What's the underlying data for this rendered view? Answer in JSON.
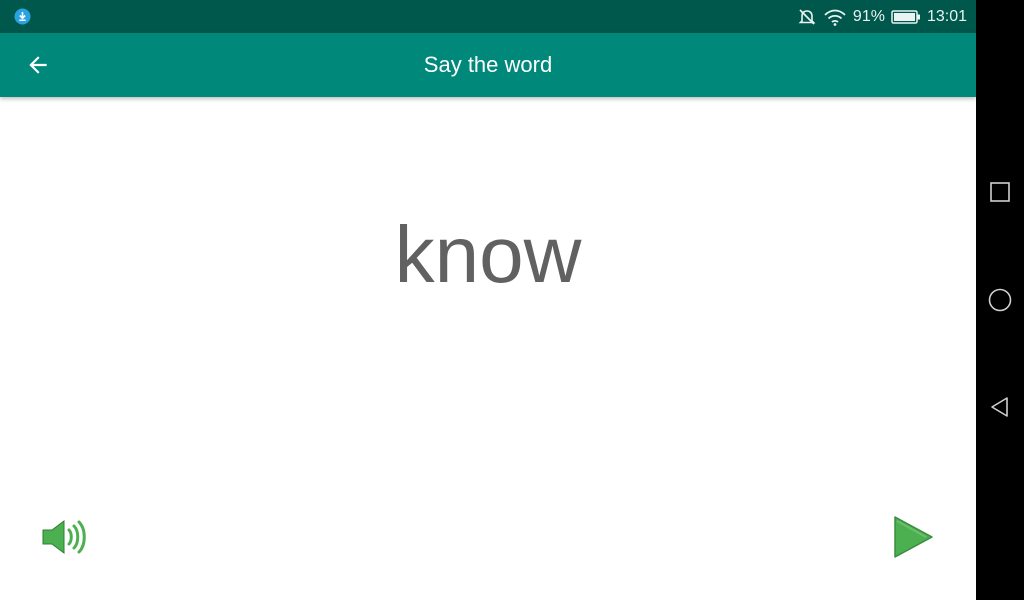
{
  "status_bar": {
    "battery_percent": "91%",
    "time": "13:01",
    "icons": [
      "download-notification-icon",
      "muted-bell-icon",
      "wifi-icon",
      "battery-icon"
    ]
  },
  "app_bar": {
    "title": "Say the word",
    "back_icon": "arrow-back-icon"
  },
  "main": {
    "word": "know",
    "speaker_icon": "speaker-icon",
    "next_icon": "play-next-icon"
  },
  "nav_bar": {
    "icons": [
      "recents-square-icon",
      "home-circle-icon",
      "back-triangle-icon"
    ]
  },
  "colors": {
    "status_bar": "#00574b",
    "app_bar": "#00897b",
    "word_text": "#616161",
    "accent_green": "#4caf50"
  }
}
